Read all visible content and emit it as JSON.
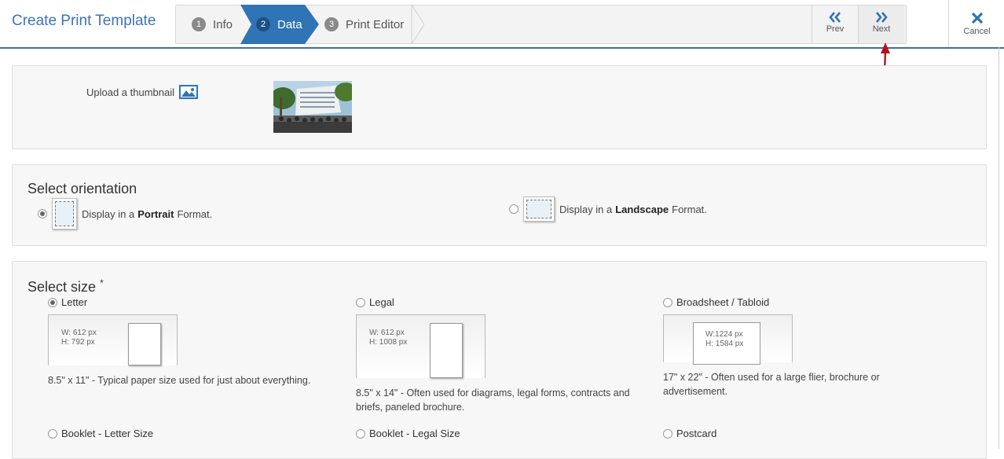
{
  "header": {
    "title": "Create Print Template",
    "steps": [
      {
        "num": "1",
        "label": "Info"
      },
      {
        "num": "2",
        "label": "Data"
      },
      {
        "num": "3",
        "label": "Print Editor"
      }
    ],
    "prev_label": "Prev",
    "next_label": "Next",
    "cancel_label": "Cancel"
  },
  "thumbnail": {
    "label": "Upload a thumbnail"
  },
  "orientation": {
    "title": "Select orientation",
    "portrait": {
      "prefix": "Display in a",
      "bold": "Portrait",
      "suffix": "Format.",
      "selected": true
    },
    "landscape": {
      "prefix": "Display in a",
      "bold": "Landscape",
      "suffix": "Format.",
      "selected": false
    }
  },
  "size": {
    "title": "Select size",
    "required_mark": "*",
    "options": [
      {
        "name": "Letter",
        "w": "W: 612 px",
        "h": "H: 792 px",
        "desc": "8.5\" x 11\" - Typical paper size used for just about everything.",
        "selected": true
      },
      {
        "name": "Legal",
        "w": "W: 612 px",
        "h": "H: 1008 px",
        "desc": "8.5\" x 14\" - Often used for diagrams, legal forms, contracts and briefs, paneled brochure.",
        "selected": false
      },
      {
        "name": "Broadsheet / Tabloid",
        "w": "W:1224 px",
        "h": "H: 1584 px",
        "desc": "17\" x 22\" - Often used for a large flier, brochure or advertisement.",
        "selected": false
      },
      {
        "name": "Booklet - Letter Size",
        "selected": false
      },
      {
        "name": "Booklet - Legal Size",
        "selected": false
      },
      {
        "name": "Postcard",
        "selected": false
      }
    ]
  },
  "colors": {
    "accent": "#3b74b8",
    "active_step": "#2f74b5",
    "arrow": "#b3141c"
  }
}
